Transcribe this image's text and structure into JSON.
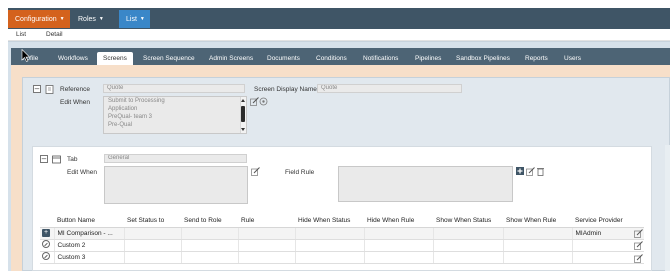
{
  "topnav": {
    "items": [
      {
        "label": "Configuration"
      },
      {
        "label": "Roles"
      },
      {
        "label": "List"
      }
    ]
  },
  "subnav": {
    "items": [
      "List",
      "Detail"
    ]
  },
  "tabs": [
    "...ofile",
    "Workflows",
    "Screens",
    "Screen Sequence",
    "Admin Screens",
    "Documents",
    "Conditions",
    "Notifications",
    "Pipelines",
    "Sandbox Pipelines",
    "Reports",
    "Users"
  ],
  "active_tab": "Screens",
  "screen": {
    "reference_label": "Reference",
    "reference_value": "Quote",
    "display_name_label": "Screen Display Name",
    "display_name_value": "Quote",
    "edit_when_label": "Edit When",
    "edit_when_options": [
      "Submit to Processing",
      "Application",
      "PreQual- team 3",
      "Pre-Qual"
    ]
  },
  "tab_section": {
    "tab_label": "Tab",
    "tab_value": "General",
    "edit_when_label": "Edit When",
    "field_rule_label": "Field Rule"
  },
  "grid": {
    "columns": [
      "Button Name",
      "Set Status to",
      "Send to Role",
      "Rule",
      "Hide When Status",
      "Hide When Rule",
      "Show When Status",
      "Show When Rule",
      "Service Provider"
    ],
    "rows": [
      {
        "name": "MI Comparison - ...",
        "provider": "MIAdmin"
      },
      {
        "name": "Custom 2",
        "provider": ""
      },
      {
        "name": "Custom 3",
        "provider": ""
      }
    ]
  }
}
